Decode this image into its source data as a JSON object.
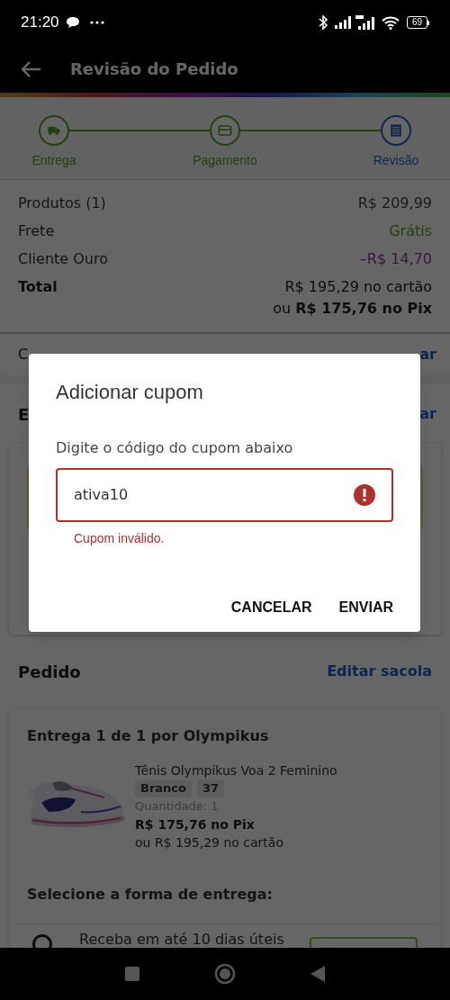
{
  "status_bar": {
    "time": "21:20",
    "battery": "69"
  },
  "app_bar": {
    "title": "Revisão do Pedido"
  },
  "steps": [
    {
      "label": "Entrega",
      "selected": false
    },
    {
      "label": "Pagamento",
      "selected": false
    },
    {
      "label": "Revisão",
      "selected": true
    }
  ],
  "summary": {
    "rows": [
      {
        "label": "Produtos (1)",
        "value": "R$ 209,99",
        "kind": "plain"
      },
      {
        "label": "Frete",
        "value": "Grátis",
        "kind": "free"
      },
      {
        "label": "Cliente Ouro",
        "value": "–R$ 14,70",
        "kind": "discount"
      }
    ],
    "total": {
      "label": "Total",
      "card": "R$ 195,29 no cartão",
      "pix": "ou **R$ 175,76 no Pix**"
    }
  },
  "coupon_row": {
    "label": "C",
    "action": "ar"
  },
  "address_section": {
    "title": "E",
    "action": "ar"
  },
  "order": {
    "title": "Pedido",
    "action": "Editar sacola",
    "shipment": {
      "title": "Entrega 1 de 1 por Olympikus",
      "product": {
        "name": "Tênis Olympikus Voa 2 Feminino",
        "tags": [
          "Branco",
          "37"
        ],
        "quantity": "Quantidade:  1",
        "price_pix": "R$ 175,76 no Pix",
        "price_card": "ou R$ 195,29 no cartão"
      },
      "delivery_prompt": "Selecione a forma de entrega:",
      "options": [
        {
          "text": "Receba em até 10 dias úteis"
        }
      ]
    }
  },
  "dialog": {
    "title": "Adicionar cupom",
    "prompt": "Digite o código do cupom abaixo",
    "input": {
      "value": "ativa10",
      "error": "Cupom inválido."
    },
    "buttons": [
      "CANCELAR",
      "ENVIAR"
    ]
  }
}
